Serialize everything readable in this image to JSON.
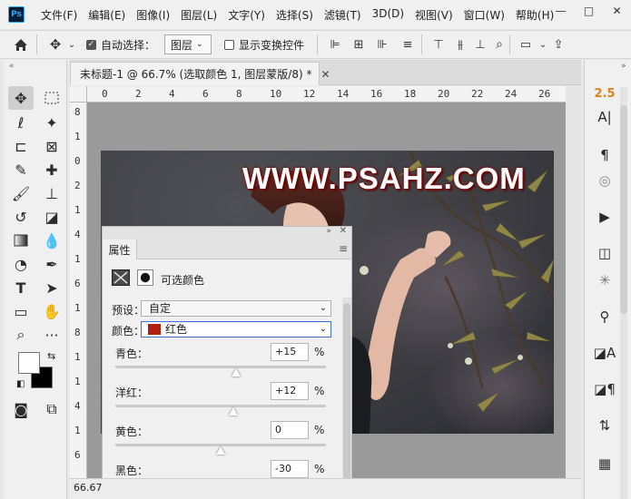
{
  "menubar": {
    "items": [
      "文件(F)",
      "编辑(E)",
      "图像(I)",
      "图层(L)",
      "文字(Y)",
      "选择(S)",
      "滤镜(T)",
      "3D(D)",
      "视图(V)",
      "窗口(W)",
      "帮助(H)"
    ],
    "window_controls": [
      "—",
      "□",
      "✕"
    ]
  },
  "options": {
    "auto_select_label": "自动选择：",
    "auto_select_checked": true,
    "layer_select_value": "图层",
    "transform_controls_label": "显示变换控件",
    "transform_controls_checked": false
  },
  "document": {
    "tab_title": "未标题-1 @ 66.7% (选取颜色 1, 图层蒙版/8) *",
    "zoom_status": "66.67",
    "ruler_h_ticks": [
      "0",
      "2",
      "4",
      "6",
      "8",
      "10",
      "12",
      "14",
      "16",
      "18",
      "20",
      "22",
      "24",
      "26"
    ],
    "ruler_v_ticks": [
      "8",
      "1",
      "0",
      "2",
      "1",
      "4",
      "1",
      "6",
      "1",
      "8",
      "1",
      "1",
      "4",
      "1",
      "6"
    ],
    "watermark_text": "WWW.PSAHZ.COM"
  },
  "properties": {
    "tab_label": "属性",
    "panel_title": "可选颜色",
    "preset_label": "预设：",
    "preset_value": "自定",
    "colors_label": "颜色：",
    "colors_value": "红色",
    "colors_swatch": "#b3200f",
    "sliders": [
      {
        "label": "青色：",
        "value": "+15",
        "unit": "%",
        "fraction": 0.575
      },
      {
        "label": "洋红：",
        "value": "+12",
        "unit": "%",
        "fraction": 0.56
      },
      {
        "label": "黄色：",
        "value": "0",
        "unit": "%",
        "fraction": 0.5
      },
      {
        "label": "黑色：",
        "value": "-30",
        "unit": "%",
        "fraction": 0.35
      }
    ]
  },
  "right_panel": {
    "top_value": "2.5"
  }
}
